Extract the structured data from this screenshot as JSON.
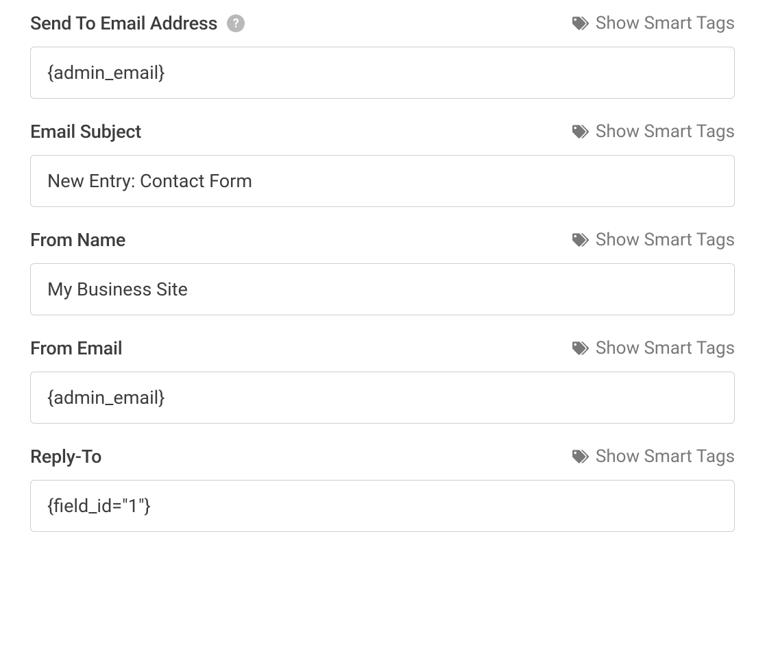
{
  "smart_tags_label": "Show Smart Tags",
  "fields": {
    "send_to": {
      "label": "Send To Email Address",
      "value": "{admin_email}",
      "has_help": true
    },
    "subject": {
      "label": "Email Subject",
      "value": "New Entry: Contact Form",
      "has_help": false
    },
    "from_name": {
      "label": "From Name",
      "value": "My Business Site",
      "has_help": false
    },
    "from_email": {
      "label": "From Email",
      "value": "{admin_email}",
      "has_help": false
    },
    "reply_to": {
      "label": "Reply-To",
      "value": "{field_id=\"1\"}",
      "has_help": false
    }
  }
}
